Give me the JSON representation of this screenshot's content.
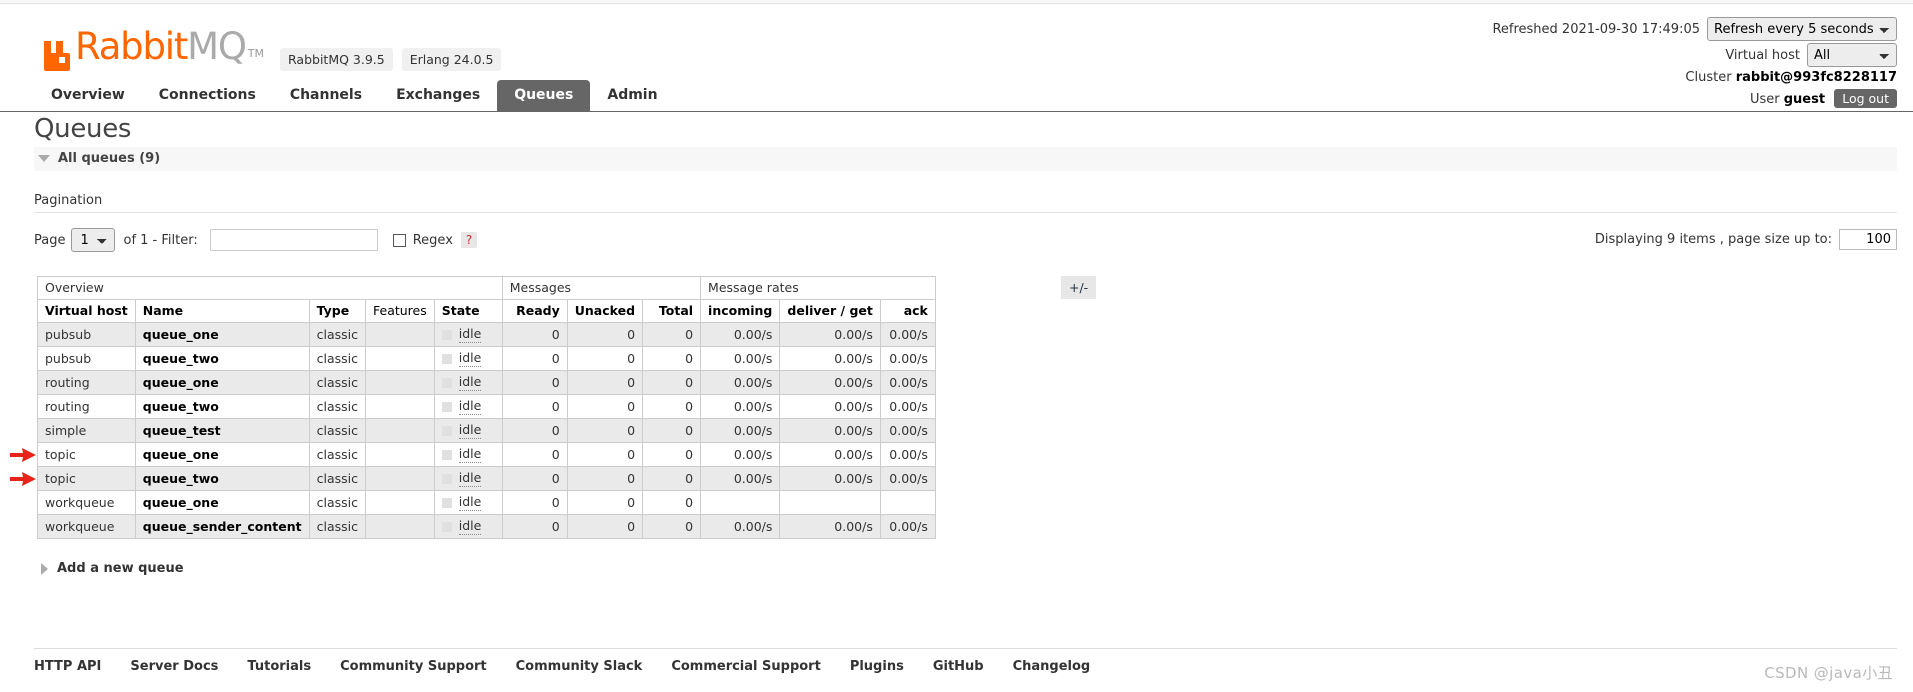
{
  "header": {
    "logo": {
      "rabbit": "Rabbit",
      "mq": "MQ",
      "tm": "TM",
      "mark_icon": "rabbitmq-logo-icon"
    },
    "badges": [
      "RabbitMQ 3.9.5",
      "Erlang 24.0.5"
    ],
    "refreshed_label": "Refreshed 2021-09-30 17:49:05",
    "refresh_select": "Refresh every 5 seconds",
    "vhost_label": "Virtual host",
    "vhost_select": "All",
    "cluster_label": "Cluster",
    "cluster_value": "rabbit@993fc8228117",
    "user_label": "User",
    "user_value": "guest",
    "logout_label": "Log out"
  },
  "nav": {
    "tabs": [
      {
        "label": "Overview",
        "active": false
      },
      {
        "label": "Connections",
        "active": false
      },
      {
        "label": "Channels",
        "active": false
      },
      {
        "label": "Exchanges",
        "active": false
      },
      {
        "label": "Queues",
        "active": true
      },
      {
        "label": "Admin",
        "active": false
      }
    ]
  },
  "page": {
    "title": "Queues",
    "section_header": "All queues (9)",
    "pagination_label": "Pagination",
    "page_word": "Page",
    "page_value": "1",
    "of_text": "of 1  - Filter:",
    "filter_value": "",
    "filter_placeholder": "",
    "regex_label": "Regex",
    "help_label": "?",
    "displaying_text": "Displaying 9 items , page size up to:",
    "page_size": "100",
    "plus_minus": "+/-",
    "add_queue": "Add a new queue"
  },
  "table": {
    "group_headers": [
      {
        "label": "Overview",
        "span": 5
      },
      {
        "label": "Messages",
        "span": 3
      },
      {
        "label": "Message rates",
        "span": 3
      }
    ],
    "columns": [
      {
        "label": "Virtual host",
        "bold": true,
        "num": false
      },
      {
        "label": "Name",
        "bold": true,
        "num": false
      },
      {
        "label": "Type",
        "bold": true,
        "num": false
      },
      {
        "label": "Features",
        "bold": false,
        "num": false
      },
      {
        "label": "State",
        "bold": true,
        "num": false
      },
      {
        "label": "Ready",
        "bold": true,
        "num": true
      },
      {
        "label": "Unacked",
        "bold": true,
        "num": true
      },
      {
        "label": "Total",
        "bold": true,
        "num": true
      },
      {
        "label": "incoming",
        "bold": true,
        "num": true
      },
      {
        "label": "deliver / get",
        "bold": true,
        "num": true
      },
      {
        "label": "ack",
        "bold": true,
        "num": true
      }
    ],
    "rows": [
      {
        "vhost": "pubsub",
        "name": "queue_one",
        "type": "classic",
        "features": "",
        "state": "idle",
        "ready": "0",
        "unacked": "0",
        "total": "0",
        "incoming": "0.00/s",
        "deliver_get": "0.00/s",
        "ack": "0.00/s",
        "marked": false
      },
      {
        "vhost": "pubsub",
        "name": "queue_two",
        "type": "classic",
        "features": "",
        "state": "idle",
        "ready": "0",
        "unacked": "0",
        "total": "0",
        "incoming": "0.00/s",
        "deliver_get": "0.00/s",
        "ack": "0.00/s",
        "marked": false
      },
      {
        "vhost": "routing",
        "name": "queue_one",
        "type": "classic",
        "features": "",
        "state": "idle",
        "ready": "0",
        "unacked": "0",
        "total": "0",
        "incoming": "0.00/s",
        "deliver_get": "0.00/s",
        "ack": "0.00/s",
        "marked": false
      },
      {
        "vhost": "routing",
        "name": "queue_two",
        "type": "classic",
        "features": "",
        "state": "idle",
        "ready": "0",
        "unacked": "0",
        "total": "0",
        "incoming": "0.00/s",
        "deliver_get": "0.00/s",
        "ack": "0.00/s",
        "marked": false
      },
      {
        "vhost": "simple",
        "name": "queue_test",
        "type": "classic",
        "features": "",
        "state": "idle",
        "ready": "0",
        "unacked": "0",
        "total": "0",
        "incoming": "0.00/s",
        "deliver_get": "0.00/s",
        "ack": "0.00/s",
        "marked": false
      },
      {
        "vhost": "topic",
        "name": "queue_one",
        "type": "classic",
        "features": "",
        "state": "idle",
        "ready": "0",
        "unacked": "0",
        "total": "0",
        "incoming": "0.00/s",
        "deliver_get": "0.00/s",
        "ack": "0.00/s",
        "marked": true
      },
      {
        "vhost": "topic",
        "name": "queue_two",
        "type": "classic",
        "features": "",
        "state": "idle",
        "ready": "0",
        "unacked": "0",
        "total": "0",
        "incoming": "0.00/s",
        "deliver_get": "0.00/s",
        "ack": "0.00/s",
        "marked": true
      },
      {
        "vhost": "workqueue",
        "name": "queue_one",
        "type": "classic",
        "features": "",
        "state": "idle",
        "ready": "0",
        "unacked": "0",
        "total": "0",
        "incoming": "",
        "deliver_get": "",
        "ack": "",
        "marked": false
      },
      {
        "vhost": "workqueue",
        "name": "queue_sender_content",
        "type": "classic",
        "features": "",
        "state": "idle",
        "ready": "0",
        "unacked": "0",
        "total": "0",
        "incoming": "0.00/s",
        "deliver_get": "0.00/s",
        "ack": "0.00/s",
        "marked": false
      }
    ]
  },
  "footer": {
    "links": [
      "HTTP API",
      "Server Docs",
      "Tutorials",
      "Community Support",
      "Community Slack",
      "Commercial Support",
      "Plugins",
      "GitHub",
      "Changelog"
    ]
  },
  "watermark": "CSDN @java小丑",
  "colors": {
    "brand_orange": "#f60",
    "tab_active_bg": "#666",
    "annotation_red": "#e8231a"
  }
}
